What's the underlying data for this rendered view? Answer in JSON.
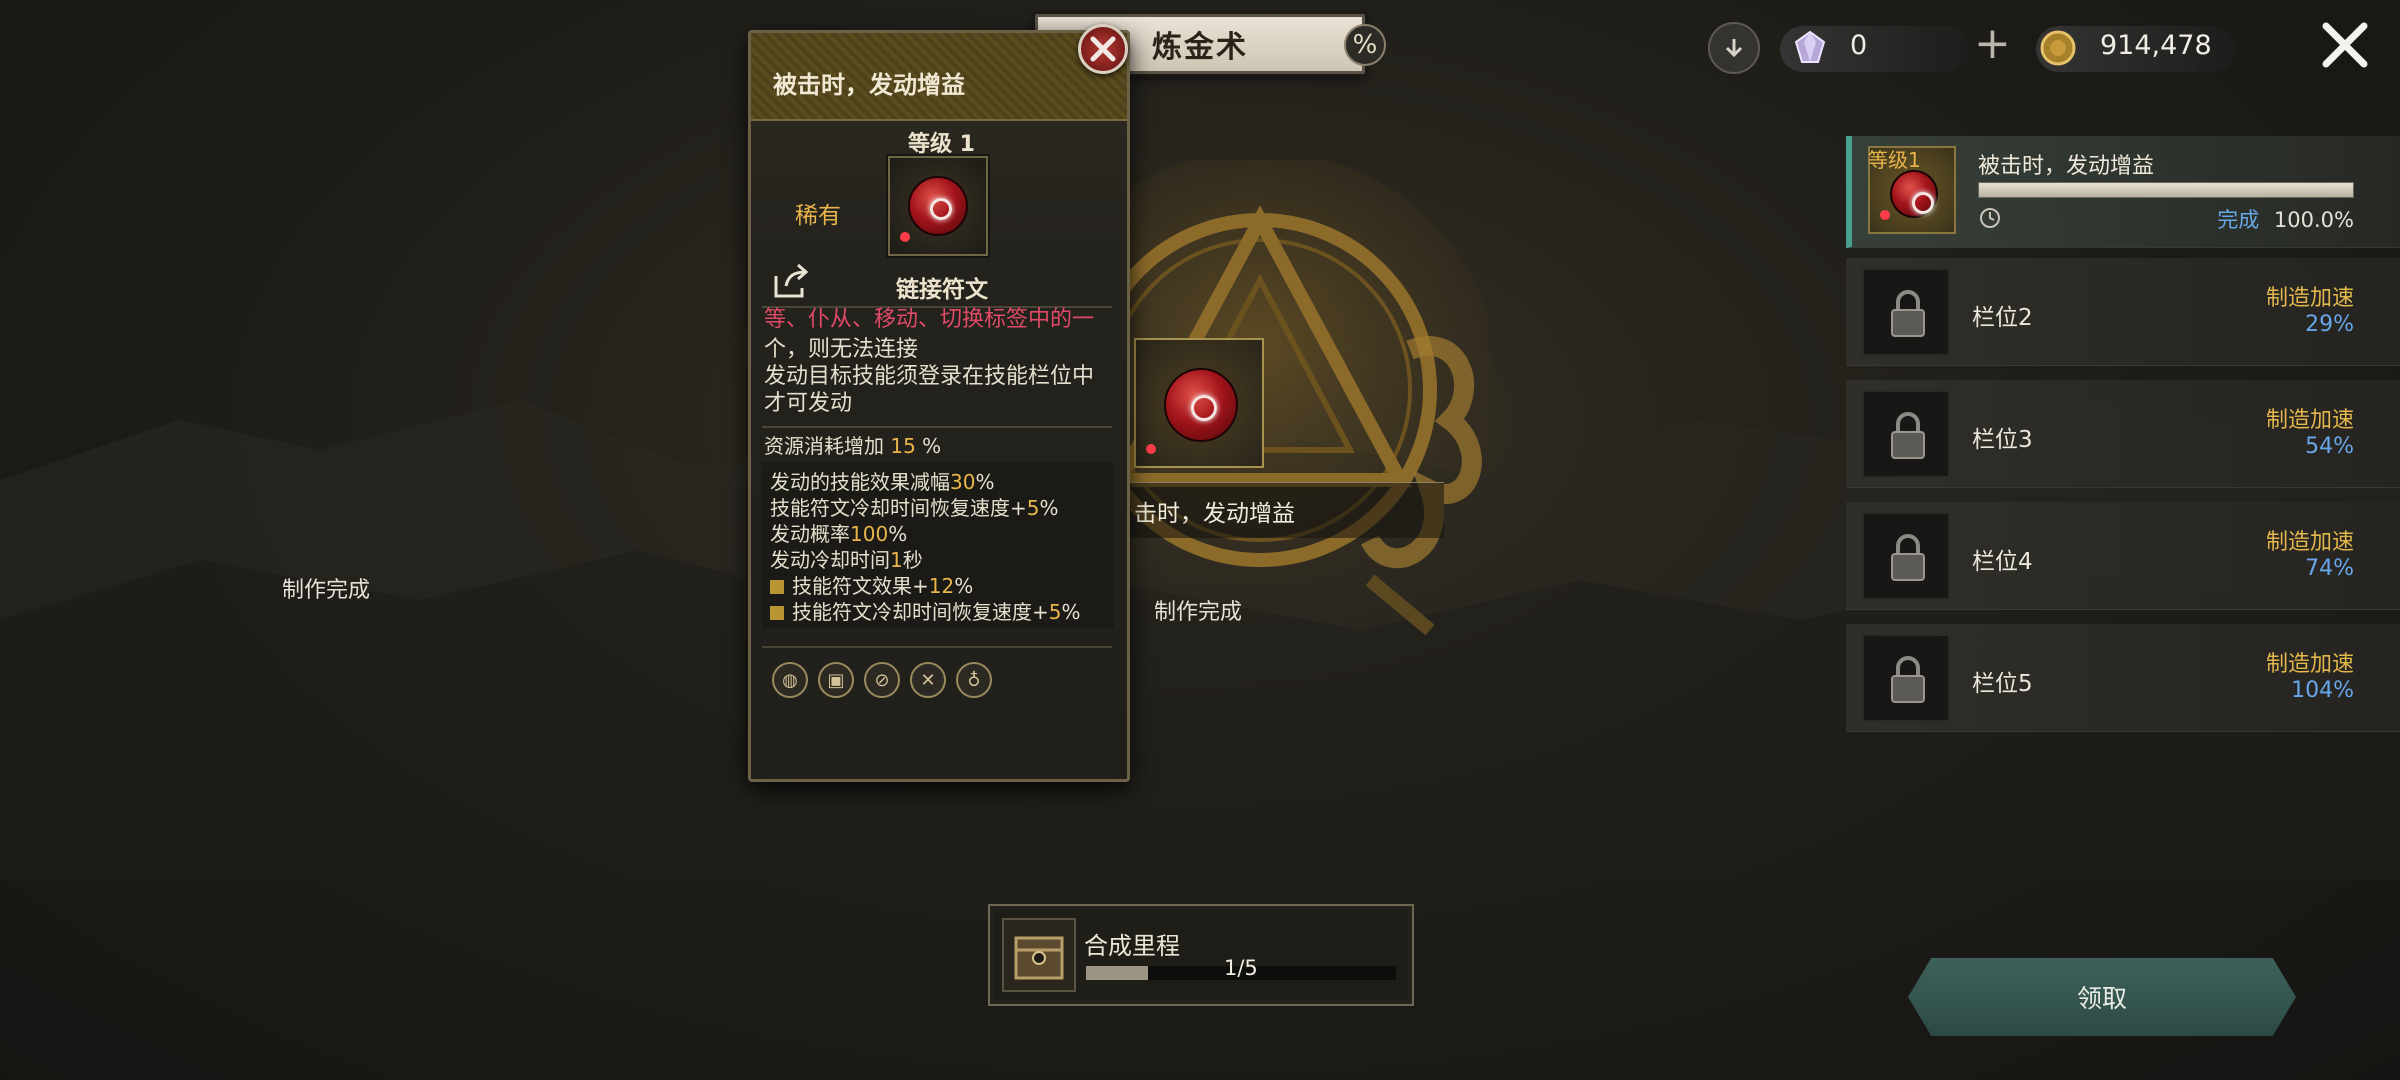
{
  "header": {
    "title": "炼金术",
    "percent_icon": "%",
    "gems": "0",
    "gold": "914,478"
  },
  "tooltip": {
    "title": "被击时，发动增益",
    "level": "等级 1",
    "rarity": "稀有",
    "gem_name": "链接符文",
    "partial_line": "等、仆从、移动、切换标签中的一",
    "desc_lines": [
      "个，则无法连接",
      "发动目标技能须登录在技能栏位中",
      "才可发动"
    ],
    "cost_prefix": "资源消耗增加",
    "cost_value": "15",
    "cost_unit": "%",
    "stats": [
      {
        "label": "发动的技能效果减幅",
        "value": "30",
        "unit": "%"
      },
      {
        "label": "技能符文冷却时间恢复速度+",
        "value": "5",
        "unit": "%"
      },
      {
        "label": "发动概率",
        "value": "100",
        "unit": "%"
      },
      {
        "label": "发动冷却时间",
        "value": "1",
        "unit": "秒"
      }
    ],
    "bonus_stats": [
      {
        "label": "技能符文效果+",
        "value": "12",
        "unit": "%"
      },
      {
        "label": "技能符文冷却时间恢复速度+",
        "value": "5",
        "unit": "%"
      }
    ],
    "icons": [
      "bag-icon",
      "chest-icon",
      "no-sword-icon",
      "tools-icon",
      "flask-icon"
    ]
  },
  "center": {
    "gem_label": "击时，发动增益",
    "craft_done": "制作完成"
  },
  "left_label": "制作完成",
  "milestone": {
    "title": "合成里程",
    "count": "1/5",
    "progress": 0.2
  },
  "claim_button": "领取",
  "slots": [
    {
      "level": "等级1",
      "name": "被击时，发动增益",
      "status": "完成",
      "percent": "100.0%",
      "progress": 1.0
    },
    {
      "name": "栏位2",
      "speed_label": "制造加速",
      "speed": "29%"
    },
    {
      "name": "栏位3",
      "speed_label": "制造加速",
      "speed": "54%"
    },
    {
      "name": "栏位4",
      "speed_label": "制造加速",
      "speed": "74%"
    },
    {
      "name": "栏位5",
      "speed_label": "制造加速",
      "speed": "104%"
    }
  ],
  "colors": {
    "gold_text": "#e9b54a",
    "blue_text": "#69a8e8",
    "accent_teal": "#4aa08e",
    "gem_red": "#a3141b"
  }
}
